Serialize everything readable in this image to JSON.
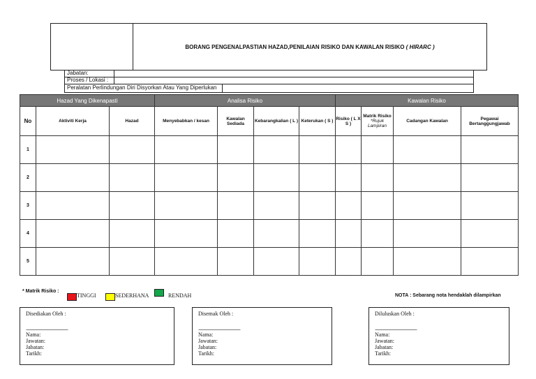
{
  "form": {
    "title": "BORANG PENGENALPASTIAN HAZAD,PENILAIAN RISIKO DAN KAWALAN RISIKO",
    "title_abbr": "( HIRARC )",
    "jabatan": "Jabatan:",
    "proses": "Proses / Lokasi :",
    "peralatan": "Peralatan Perlindungan Diri Disyorkan Atau Yang Diperlukan"
  },
  "table": {
    "groups": [
      "Hazad Yang Dikenapasti",
      "Analisa Risiko",
      "Kawalan Risiko"
    ],
    "headers": [
      "No",
      "Aktiviti Kerja",
      "Hazad",
      "Menyebabkan / kesan",
      "Kawalan Sediada",
      "Kebarangkalian ( L )",
      "Keterukan ( S )",
      "Risiko ( L X S )",
      "Matrik Risiko",
      "*Rujuk Lampiran",
      "Cadangan Kawalan",
      "Pegawai Bertanggungjawab"
    ],
    "rows": [
      "1",
      "2",
      "3",
      "4",
      "5"
    ]
  },
  "legend": {
    "label": "* Matrik Risiko  :",
    "items": [
      {
        "label": "TINGGI",
        "color": "#e8141b"
      },
      {
        "label": "SEDERHANA",
        "color": "#ffff00"
      },
      {
        "label": "RENDAH",
        "color": "#12a84a"
      }
    ]
  },
  "nota": "NOTA : Sebarang nota hendaklah dilampirkan",
  "signatures": [
    {
      "title": "Disediakan Oleh :"
    },
    {
      "title": "Disemak Oleh :"
    },
    {
      "title": "Diluluskan Oleh :"
    }
  ],
  "sig_fields": {
    "dots": "............................................................",
    "nama": "Nama:",
    "jawatan": "Jawatan:",
    "jabatan": "Jabatan:",
    "tarikh": "Tarikh:"
  }
}
